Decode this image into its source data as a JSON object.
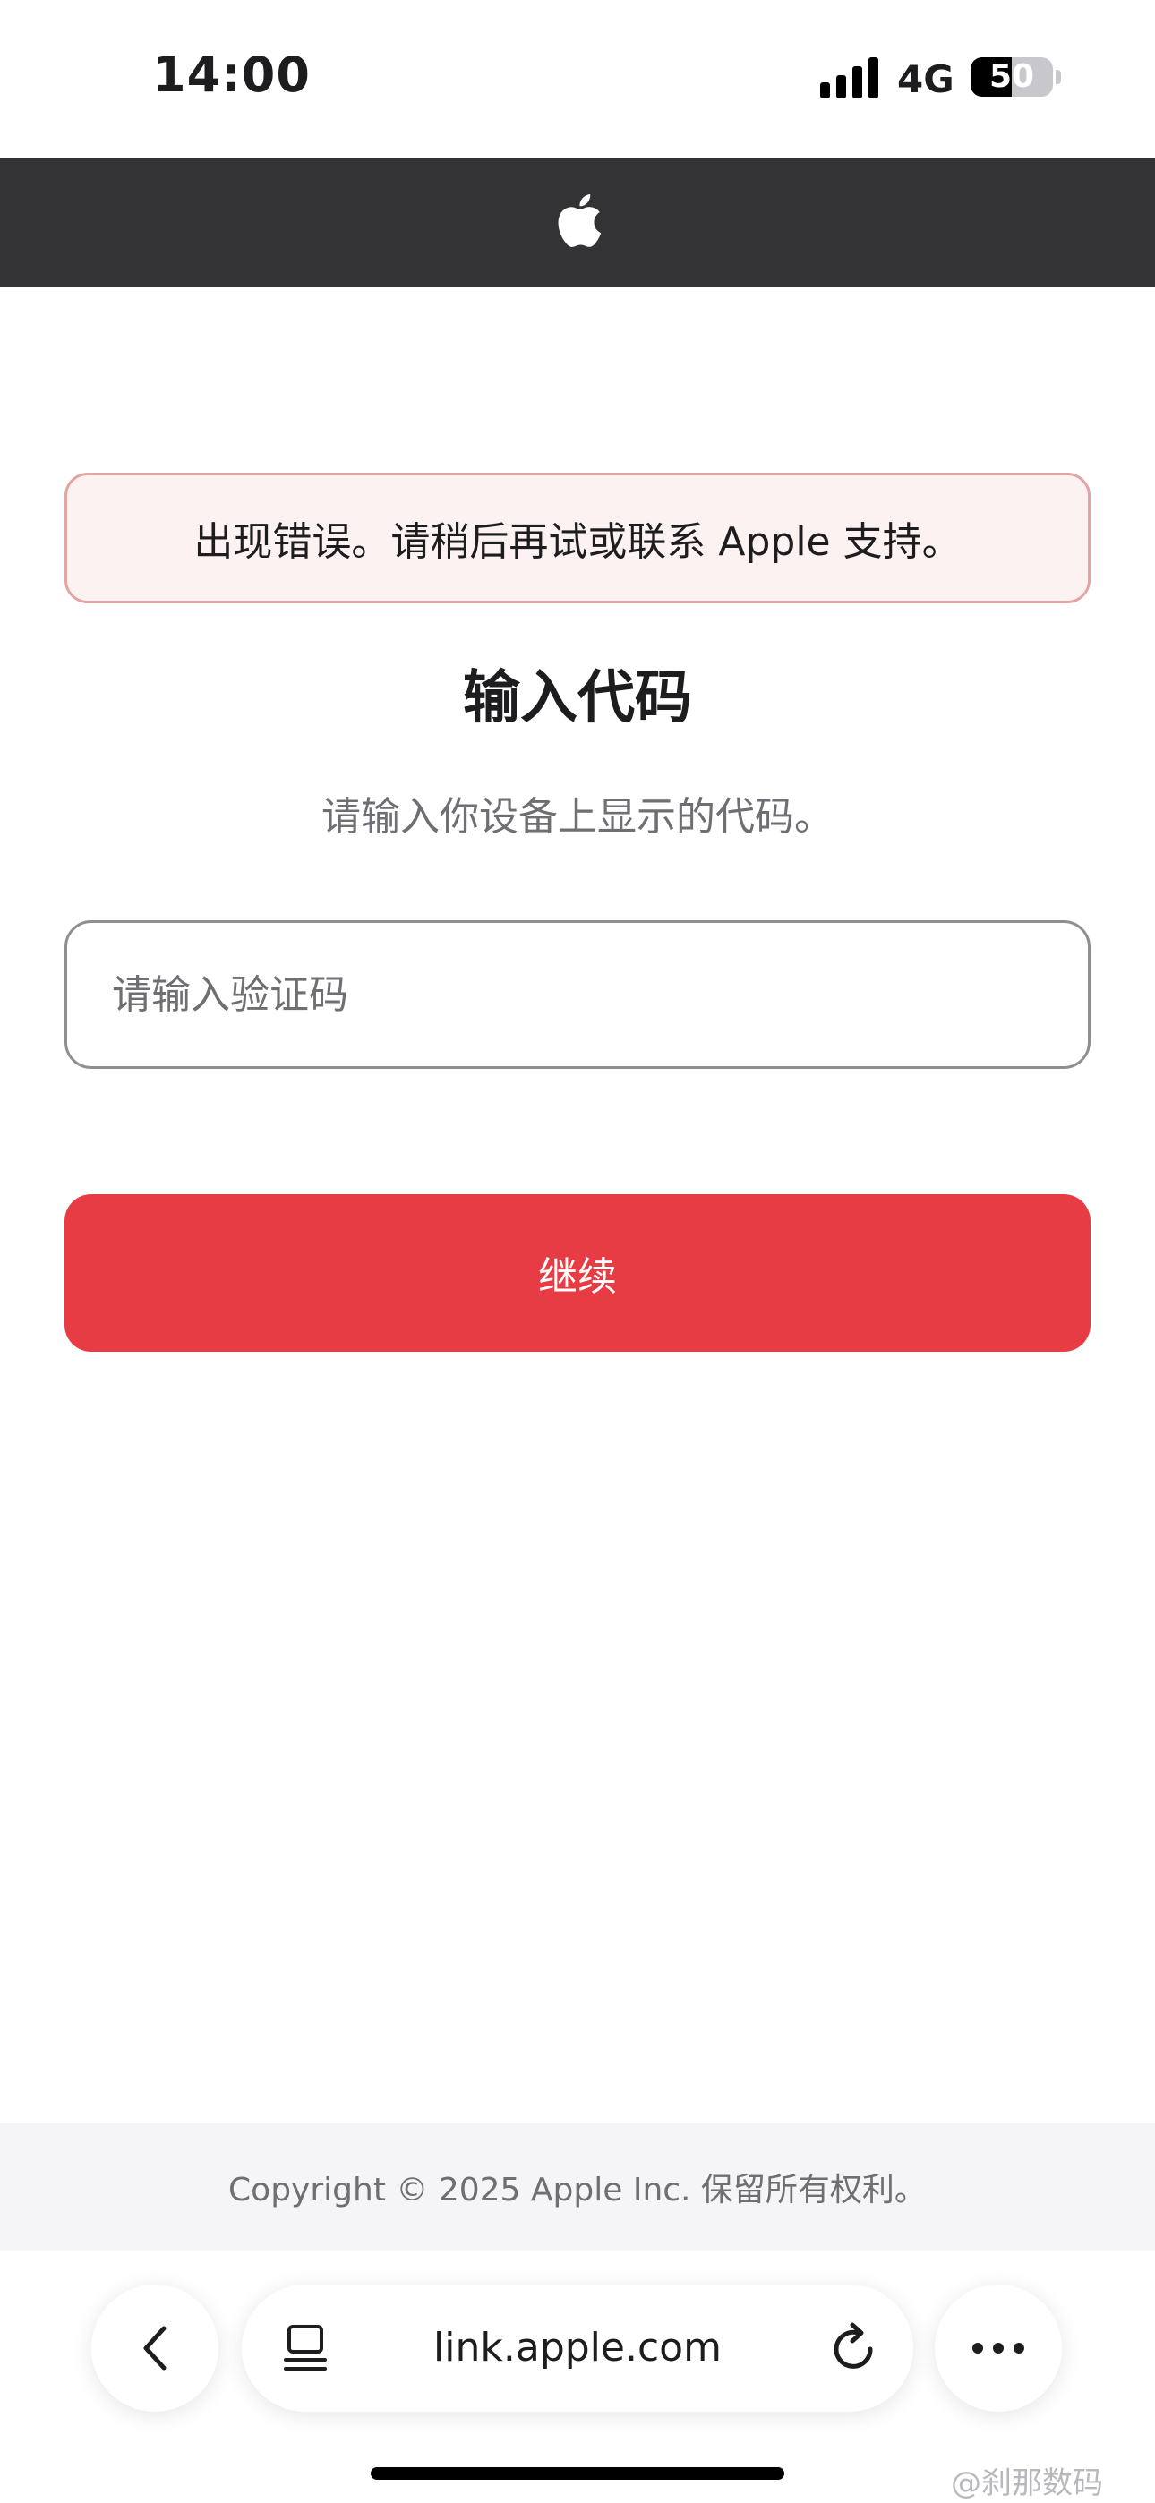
{
  "status_bar": {
    "time": "14:00",
    "network": "4G",
    "battery_level": "50",
    "battery_fraction": 0.5,
    "signal_icon": "cellular-signal-icon"
  },
  "header": {
    "logo_icon": "apple-logo-icon"
  },
  "error_banner": {
    "message": "出现错误。请稍后再试或联系 Apple 支持。",
    "border_color": "#e3a4a4",
    "background_color": "#fdf2f2"
  },
  "main": {
    "title": "输入代码",
    "subtitle": "请输入你设备上显示的代码。",
    "code_input": {
      "value": "",
      "placeholder": "请输入验证码"
    },
    "continue_label": "继续",
    "accent_color": "#e83c44"
  },
  "footer": {
    "copyright": "Copyright © 2025 Apple Inc. 保留所有权利。"
  },
  "browser_toolbar": {
    "back_icon": "chevron-left-icon",
    "tabs_icon": "tabs-icon",
    "url": "link.apple.com",
    "reload_icon": "reload-icon",
    "more_icon": "more-icon"
  },
  "watermark": "@刹那数码"
}
